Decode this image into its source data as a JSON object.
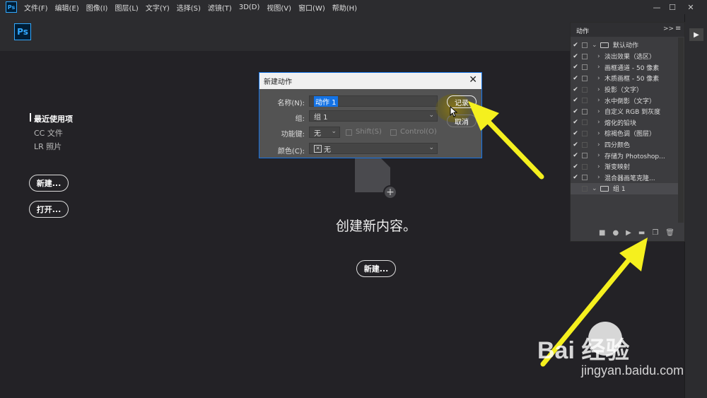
{
  "menubar": {
    "logo": "Ps",
    "items": [
      "文件(F)",
      "编辑(E)",
      "图像(I)",
      "图层(L)",
      "文字(Y)",
      "选择(S)",
      "滤镜(T)",
      "3D(D)",
      "视图(V)",
      "窗口(W)",
      "帮助(H)"
    ],
    "window_controls": [
      "—",
      "☐",
      "✕"
    ]
  },
  "header": {
    "logo": "Ps"
  },
  "home": {
    "nav": [
      "最近使用项",
      "CC 文件",
      "LR 照片"
    ],
    "new_button": "新建...",
    "open_button": "打开...",
    "create_text": "创建新内容。",
    "center_new_button": "新建..."
  },
  "dialog": {
    "title": "新建动作",
    "close": "✕",
    "name_label": "名称(N):",
    "name_value": "动作 1",
    "group_label": "组:",
    "group_value": "组 1",
    "fkey_label": "功能键:",
    "fkey_value": "无",
    "shift_label": "Shift(S)",
    "control_label": "Control(O)",
    "color_label": "颜色(C):",
    "color_value": "无",
    "record_button": "记录",
    "cancel_button": "取消"
  },
  "actions_panel": {
    "tab": "动作",
    "collapse": ">>",
    "menu": "≡",
    "set_name": "默认动作",
    "items": [
      "淡出效果（选区）",
      "画框通道 - 50 像素",
      "木质画框 - 50 像素",
      "投影（文字）",
      "水中倒影（文字）",
      "自定义 RGB 到灰度",
      "熔化的铅块",
      "棕褐色调（图层）",
      "四分颜色",
      "存储为 Photoshop...",
      "渐变映射",
      "混合器画笔克隆..."
    ],
    "item_boxes": [
      true,
      true,
      true,
      false,
      false,
      true,
      false,
      false,
      false,
      true,
      false,
      true
    ],
    "new_group": "组 1",
    "footer_icons": [
      "■",
      "●",
      "▶",
      "▬",
      "❐",
      "🗑"
    ]
  },
  "watermark": {
    "brand": "Bai  经验",
    "url": "jingyan.baidu.com"
  },
  "colors": {
    "accent": "#31a8ff",
    "arrow": "#f5f01e",
    "dialog_border": "#1473e6"
  }
}
